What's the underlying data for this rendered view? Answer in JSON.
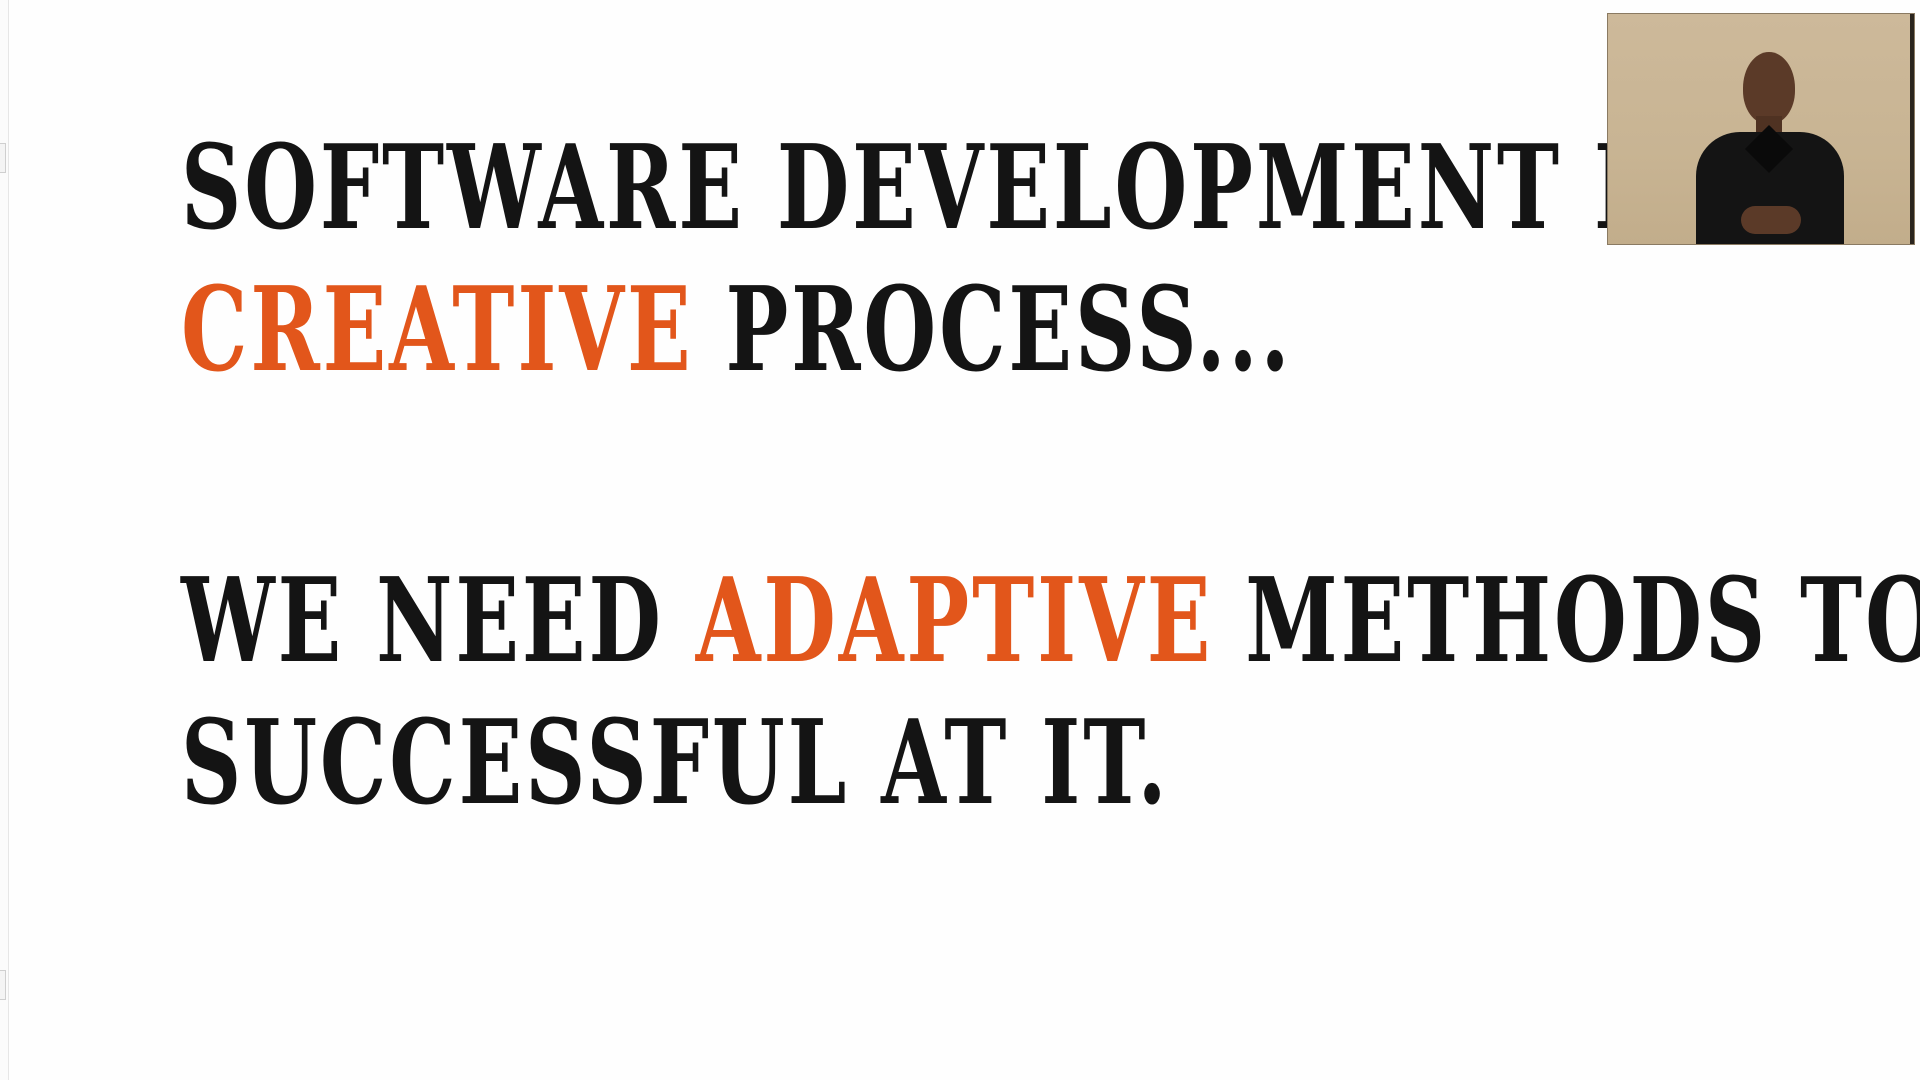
{
  "slide": {
    "statement_1": {
      "line_1": "SOFTWARE DEVELOPMENT IS A",
      "line_2_accent": "CREATIVE",
      "line_2_rest": " PROCESS..."
    },
    "statement_2": {
      "line_1_start": "WE NEED ",
      "line_1_accent": "ADAPTIVE",
      "line_1_end": " METHODS TO BE",
      "line_2": "SUCCESSFUL AT IT."
    }
  },
  "colors": {
    "text": "#141414",
    "accent": "#e2561b",
    "background": "#fefefe"
  },
  "presenter_video": {
    "icon": "presenter-webcam-feed"
  }
}
